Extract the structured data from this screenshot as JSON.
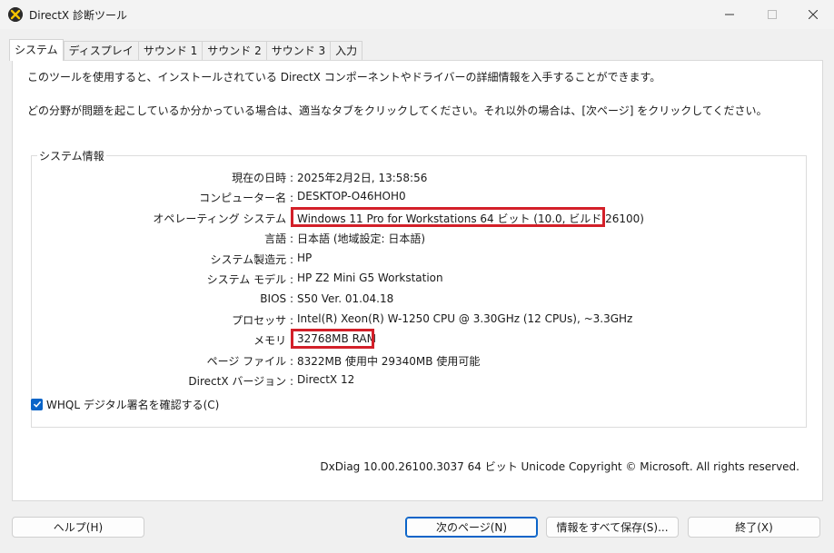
{
  "window": {
    "title": "DirectX 診断ツール"
  },
  "tabs": [
    {
      "label": "システム"
    },
    {
      "label": "ディスプレイ"
    },
    {
      "label": "サウンド 1"
    },
    {
      "label": "サウンド 2"
    },
    {
      "label": "サウンド 3"
    },
    {
      "label": "入力"
    }
  ],
  "panel": {
    "intro_line1": "このツールを使用すると、インストールされている DirectX コンポーネントやドライバーの詳細情報を入手することができます。",
    "intro_line2": "どの分野が問題を起こしているか分かっている場合は、適当なタブをクリックしてください。それ以外の場合は、[次ページ] をクリックしてください。",
    "group_label": "システム情報",
    "system_info": [
      {
        "label": "現在の日時 :",
        "value": "2025年2月2日, 13:58:56"
      },
      {
        "label": "コンピューター名 :",
        "value": "DESKTOP-O46HOH0"
      },
      {
        "label": "オペレーティング システム :",
        "value": "Windows 11 Pro for Workstations 64 ビット (10.0, ビルド 26100)"
      },
      {
        "label": "言語 :",
        "value": "日本語 (地域設定: 日本語)"
      },
      {
        "label": "システム製造元 :",
        "value": "HP"
      },
      {
        "label": "システム モデル :",
        "value": "HP Z2 Mini G5 Workstation"
      },
      {
        "label": "BIOS :",
        "value": "S50 Ver. 01.04.18"
      },
      {
        "label": "プロセッサ :",
        "value": "Intel(R) Xeon(R) W-1250 CPU @ 3.30GHz (12 CPUs), ~3.3GHz"
      },
      {
        "label": "メモリ :",
        "value": "32768MB RAM"
      },
      {
        "label": "ページ ファイル :",
        "value": "8322MB 使用中 29340MB 使用可能"
      },
      {
        "label": "DirectX バージョン :",
        "value": "DirectX 12"
      }
    ],
    "whql_checkbox_label": "WHQL デジタル署名を確認する(C)",
    "whql_checked": true,
    "footer": "DxDiag 10.00.26100.3037 64 ビット Unicode  Copyright © Microsoft. All rights reserved."
  },
  "buttons": {
    "help": "ヘルプ(H)",
    "next_page": "次のページ(N)",
    "save_all": "情報をすべて保存(S)...",
    "exit": "終了(X)"
  },
  "colors": {
    "highlight": "#d32029",
    "accent": "#0a64c8"
  }
}
